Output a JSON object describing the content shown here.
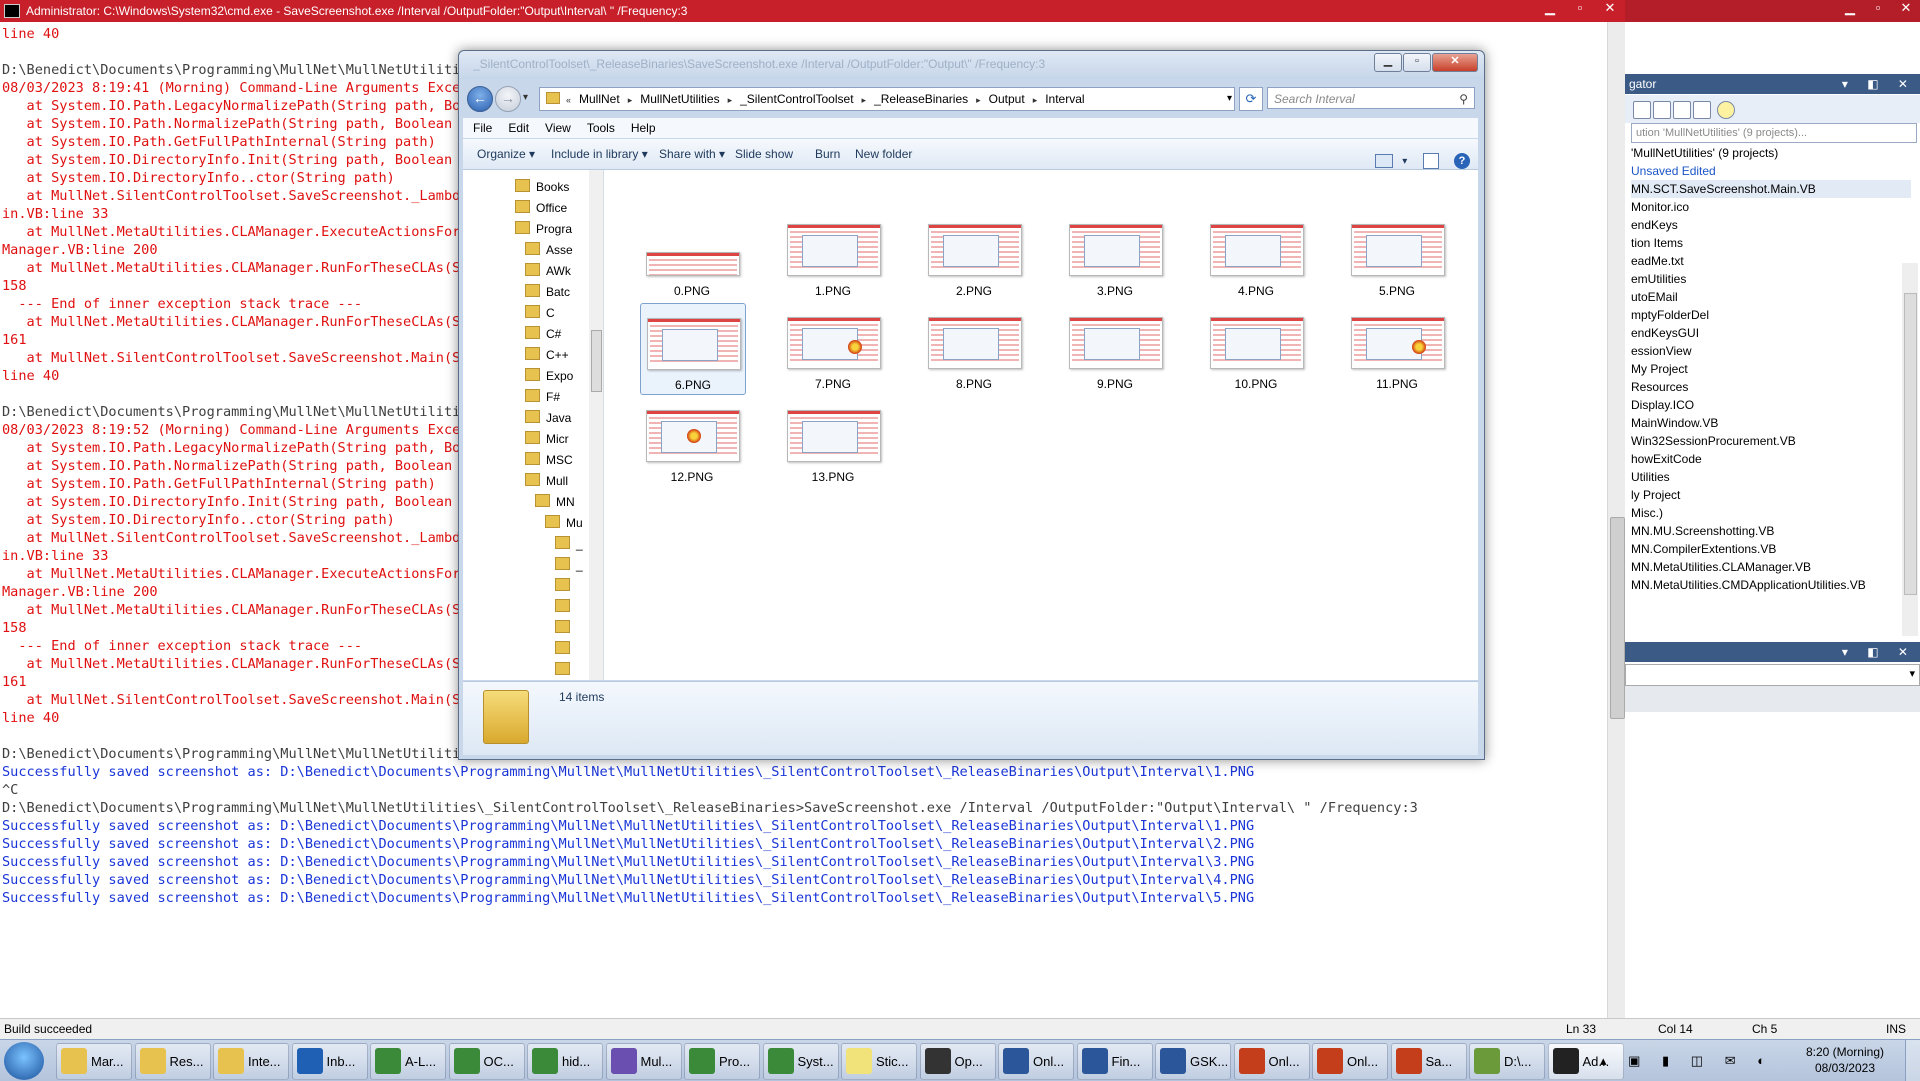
{
  "cmd": {
    "title": "Administrator: C:\\Windows\\System32\\cmd.exe - SaveScreenshot.exe  /Interval /OutputFolder:\"Output\\Interval\\ \" /Frequency:3",
    "lines": [
      {
        "t": "line 40",
        "c": "red"
      },
      {
        "t": "",
        "c": "gray"
      },
      {
        "t": "D:\\Benedict\\Documents\\Programming\\MullNet\\MullNetUtilitie",
        "c": "gray"
      },
      {
        "t": "08/03/2023 8:19:41 (Morning) Command-Line Arguments Excep                                                                                 ters in path.",
        "c": "red"
      },
      {
        "t": "   at System.IO.Path.LegacyNormalizePath(String path, Boo",
        "c": "red"
      },
      {
        "t": "   at System.IO.Path.NormalizePath(String path, Boolean f",
        "c": "red"
      },
      {
        "t": "   at System.IO.Path.GetFullPathInternal(String path)",
        "c": "red"
      },
      {
        "t": "   at System.IO.DirectoryInfo.Init(String path, Boolean c",
        "c": "red"
      },
      {
        "t": "   at System.IO.DirectoryInfo..ctor(String path)",
        "c": "red"
      },
      {
        "t": "   at MullNet.SilentControlToolset.SaveScreenshot._Lambda                                                                                 aveScreenshot.Ma",
        "c": "red"
      },
      {
        "t": "in.VB:line 33",
        "c": "red"
      },
      {
        "t": "   at MullNet.MetaUtilities.CLAManager.ExecuteActionsForS                                                                                 etaUtilities.CLA",
        "c": "red"
      },
      {
        "t": "Manager.VB:line 200",
        "c": "red"
      },
      {
        "t": "   at MullNet.MetaUtilities.CLAManager.RunForTheseCLAs(St                                                                                 anager.VB:line",
        "c": "red"
      },
      {
        "t": "158",
        "c": "red"
      },
      {
        "t": "  --- End of inner exception stack trace ---",
        "c": "red"
      },
      {
        "t": "   at MullNet.MetaUtilities.CLAManager.RunForTheseCLAs(St                                                                                 anager.VB:line",
        "c": "red"
      },
      {
        "t": "161",
        "c": "red"
      },
      {
        "t": "   at MullNet.SilentControlToolset.SaveScreenshot.Main(St                                                                                 enshot.Main.VB:",
        "c": "red"
      },
      {
        "t": "line 40",
        "c": "red"
      },
      {
        "t": "",
        "c": "gray"
      },
      {
        "t": "D:\\Benedict\\Documents\\Programming\\MullNet\\MullNetUtilitie",
        "c": "gray"
      },
      {
        "t": "08/03/2023 8:19:52 (Morning) Command-Line Arguments Excep                                                                                 ters in path.",
        "c": "red"
      },
      {
        "t": "   at System.IO.Path.LegacyNormalizePath(String path, Boo",
        "c": "red"
      },
      {
        "t": "   at System.IO.Path.NormalizePath(String path, Boolean f",
        "c": "red"
      },
      {
        "t": "   at System.IO.Path.GetFullPathInternal(String path)",
        "c": "red"
      },
      {
        "t": "   at System.IO.DirectoryInfo.Init(String path, Boolean c",
        "c": "red"
      },
      {
        "t": "   at System.IO.DirectoryInfo..ctor(String path)",
        "c": "red"
      },
      {
        "t": "   at MullNet.SilentControlToolset.SaveScreenshot._Lambda                                                                                 aveScreenshot.Ma",
        "c": "red"
      },
      {
        "t": "in.VB:line 33",
        "c": "red"
      },
      {
        "t": "   at MullNet.MetaUtilities.CLAManager.ExecuteActionsForS                                                                                 etaUtilities.CLA",
        "c": "red"
      },
      {
        "t": "Manager.VB:line 200",
        "c": "red"
      },
      {
        "t": "   at MullNet.MetaUtilities.CLAManager.RunForTheseCLAs(St                                                                                 anager.VB:line",
        "c": "red"
      },
      {
        "t": "158",
        "c": "red"
      },
      {
        "t": "  --- End of inner exception stack trace ---",
        "c": "red"
      },
      {
        "t": "   at MullNet.MetaUtilities.CLAManager.RunForTheseCLAs(St                                                                                 anager.VB:line",
        "c": "red"
      },
      {
        "t": "161",
        "c": "red"
      },
      {
        "t": "   at MullNet.SilentControlToolset.SaveScreenshot.Main(St                                                                                 enshot.Main.VB:",
        "c": "red"
      },
      {
        "t": "line 40",
        "c": "red"
      },
      {
        "t": "",
        "c": "gray"
      },
      {
        "t": "D:\\Benedict\\Documents\\Programming\\MullNet\\MullNetUtilitie",
        "c": "gray"
      },
      {
        "t": "Successfully saved screenshot as: D:\\Benedict\\Documents\\Programming\\MullNet\\MullNetUtilities\\_SilentControlToolset\\_ReleaseBinaries\\Output\\Interval\\1.PNG",
        "c": "blue"
      },
      {
        "t": "^C",
        "c": "gray"
      },
      {
        "t": "D:\\Benedict\\Documents\\Programming\\MullNet\\MullNetUtilities\\_SilentControlToolset\\_ReleaseBinaries>SaveScreenshot.exe /Interval /OutputFolder:\"Output\\Interval\\ \" /Frequency:3",
        "c": "gray"
      },
      {
        "t": "Successfully saved screenshot as: D:\\Benedict\\Documents\\Programming\\MullNet\\MullNetUtilities\\_SilentControlToolset\\_ReleaseBinaries\\Output\\Interval\\1.PNG",
        "c": "blue"
      },
      {
        "t": "Successfully saved screenshot as: D:\\Benedict\\Documents\\Programming\\MullNet\\MullNetUtilities\\_SilentControlToolset\\_ReleaseBinaries\\Output\\Interval\\2.PNG",
        "c": "blue"
      },
      {
        "t": "Successfully saved screenshot as: D:\\Benedict\\Documents\\Programming\\MullNet\\MullNetUtilities\\_SilentControlToolset\\_ReleaseBinaries\\Output\\Interval\\3.PNG",
        "c": "blue"
      },
      {
        "t": "Successfully saved screenshot as: D:\\Benedict\\Documents\\Programming\\MullNet\\MullNetUtilities\\_SilentControlToolset\\_ReleaseBinaries\\Output\\Interval\\4.PNG",
        "c": "blue"
      },
      {
        "t": "Successfully saved screenshot as: D:\\Benedict\\Documents\\Programming\\MullNet\\MullNetUtilities\\_SilentControlToolset\\_ReleaseBinaries\\Output\\Interval\\5.PNG",
        "c": "blue"
      }
    ]
  },
  "vs": {
    "panel_title": "gator",
    "search_placeholder": "ution 'MullNetUtilities' (9 projects)...",
    "tree": [
      {
        "t": "'MullNetUtilities' (9 projects)",
        "sel": false
      },
      {
        "t": "  Unsaved   Edited",
        "sel": false,
        "blue": true
      },
      {
        "t": "MN.SCT.SaveScreenshot.Main.VB",
        "sel": true
      },
      {
        "t": "  Monitor.ico",
        "sel": false
      },
      {
        "t": "endKeys",
        "sel": false
      },
      {
        "t": "tion Items",
        "sel": false
      },
      {
        "t": "eadMe.txt",
        "sel": false
      },
      {
        "t": "emUtilities",
        "sel": false
      },
      {
        "t": "utoEMail",
        "sel": false
      },
      {
        "t": "mptyFolderDel",
        "sel": false
      },
      {
        "t": "endKeysGUI",
        "sel": false
      },
      {
        "t": "essionView",
        "sel": false
      },
      {
        "t": "  My Project",
        "sel": false
      },
      {
        "t": "  Resources",
        "sel": false
      },
      {
        "t": "  Display.ICO",
        "sel": false
      },
      {
        "t": "  MainWindow.VB",
        "sel": false
      },
      {
        "t": "  Win32SessionProcurement.VB",
        "sel": false
      },
      {
        "t": "howExitCode",
        "sel": false
      },
      {
        "t": "Utilities",
        "sel": false
      },
      {
        "t": "ly Project",
        "sel": false
      },
      {
        "t": "Misc.)",
        "sel": false
      },
      {
        "t": "  MN.MU.Screenshotting.VB",
        "sel": false
      },
      {
        "t": "MN.CompilerExtentions.VB",
        "sel": false
      },
      {
        "t": "MN.MetaUtilities.CLAManager.VB",
        "sel": false
      },
      {
        "t": "MN.MetaUtilities.CMDApplicationUtilities.VB",
        "sel": false
      }
    ],
    "status": {
      "build": "Build succeeded",
      "ln": "Ln 33",
      "col": "Col 14",
      "ch": "Ch 5",
      "ins": "INS"
    }
  },
  "explorer": {
    "title": "_SilentControlToolset\\_ReleaseBinaries\\SaveScreenshot.exe  /Interval /OutputFolder:\"Output\\\" /Frequency:3",
    "breadcrumbs": [
      "MullNet",
      "MullNetUtilities",
      "_SilentControlToolset",
      "_ReleaseBinaries",
      "Output",
      "Interval"
    ],
    "search_placeholder": "Search Interval",
    "menu": [
      "File",
      "Edit",
      "View",
      "Tools",
      "Help"
    ],
    "commands": [
      "Organize ▾",
      "Include in library ▾",
      "Share with ▾",
      "Slide show",
      "Burn",
      "New folder"
    ],
    "nav": [
      "Books",
      "Office",
      "Progra",
      "Asse",
      "AWk",
      "Batc",
      "C",
      "C#",
      "C++",
      "Expo",
      "F#",
      "Java",
      "Micr",
      "MSC",
      "Mull",
      "MN",
      "Mu",
      "_",
      "_",
      "",
      "",
      "",
      "",
      ""
    ],
    "files": [
      "0.PNG",
      "1.PNG",
      "2.PNG",
      "3.PNG",
      "4.PNG",
      "5.PNG",
      "6.PNG",
      "7.PNG",
      "8.PNG",
      "9.PNG",
      "10.PNG",
      "11.PNG",
      "12.PNG",
      "13.PNG"
    ],
    "item_count": "14 items"
  },
  "taskbar": {
    "items": [
      "Mar...",
      "Res...",
      "Inte...",
      "Inb...",
      "A-L...",
      "OC...",
      "hid...",
      "Mul...",
      "Pro...",
      "Syst...",
      "Stic...",
      "Op...",
      "Onl...",
      "Fin...",
      "GSK...",
      "Onl...",
      "Onl...",
      "Sa...",
      "D:\\...",
      "Ad..."
    ],
    "clock_time": "8:20 (Morning)",
    "clock_date": "08/03/2023"
  }
}
